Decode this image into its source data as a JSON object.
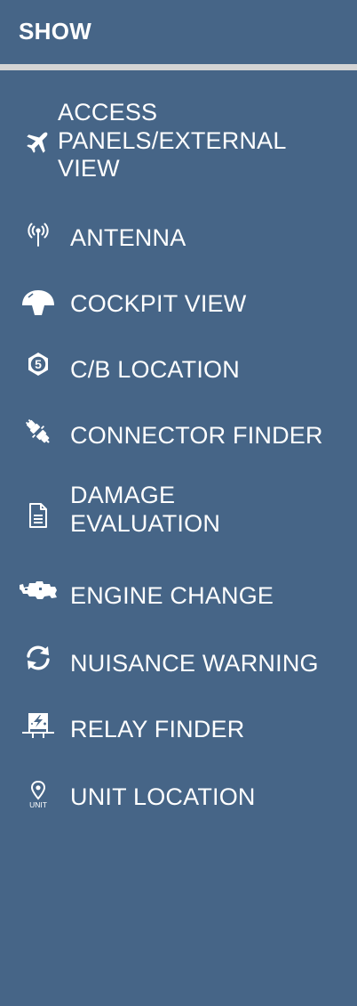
{
  "header": {
    "title": "SHOW"
  },
  "menu": {
    "items": [
      {
        "label": "ACCESS\nPANELS/EXTERNAL\nVIEW",
        "icon": "airplane-icon"
      },
      {
        "label": "ANTENNA",
        "icon": "antenna-icon"
      },
      {
        "label": "COCKPIT VIEW",
        "icon": "cockpit-icon"
      },
      {
        "label": "C/B LOCATION",
        "icon": "circuit-breaker-icon",
        "icon_text": "5"
      },
      {
        "label": "CONNECTOR FINDER",
        "icon": "connector-icon"
      },
      {
        "label": "DAMAGE\nEVALUATION",
        "icon": "document-icon"
      },
      {
        "label": "ENGINE CHANGE",
        "icon": "engine-icon"
      },
      {
        "label": "NUISANCE WARNING",
        "icon": "refresh-icon"
      },
      {
        "label": "RELAY FINDER",
        "icon": "relay-icon"
      },
      {
        "label": "UNIT LOCATION",
        "icon": "unit-location-icon",
        "icon_text": "UNIT"
      }
    ]
  },
  "colors": {
    "background": "#466587",
    "divider": "#d4d4d4",
    "text": "#ffffff"
  }
}
